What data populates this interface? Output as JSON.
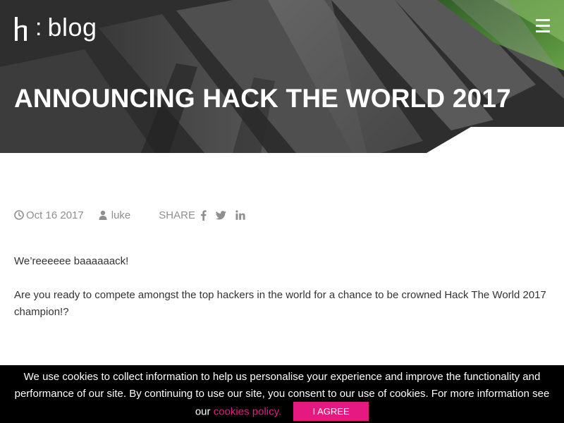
{
  "header": {
    "logo_text": "blog",
    "logo_separator": ":",
    "menu_icon": "hamburger-menu-icon"
  },
  "post": {
    "title": "ANNOUNCING HACK THE WORLD 2017",
    "date": "Oct 16 2017",
    "author": "luke",
    "share_label": "SHARE",
    "share_icons": [
      "facebook-icon",
      "twitter-icon",
      "linkedin-icon"
    ],
    "paragraphs": [
      "We’reeeeee baaaaaack!",
      "Are you ready to compete amongst the top hackers in the world for a chance to be crowned Hack The World 2017 champion!?"
    ]
  },
  "cookie_banner": {
    "text": "We use cookies to collect information to help us personalise your experience and improve the functionality and performance of our site. By continuing to use our site, you consent to our use of cookies. For more information see our",
    "link_label": "cookies policy.",
    "agree_label": "I AGREE"
  },
  "colors": {
    "accent_pink": "#e5197f",
    "hero_green": "#5d9a3e",
    "meta_grey": "#8f8f8f"
  }
}
